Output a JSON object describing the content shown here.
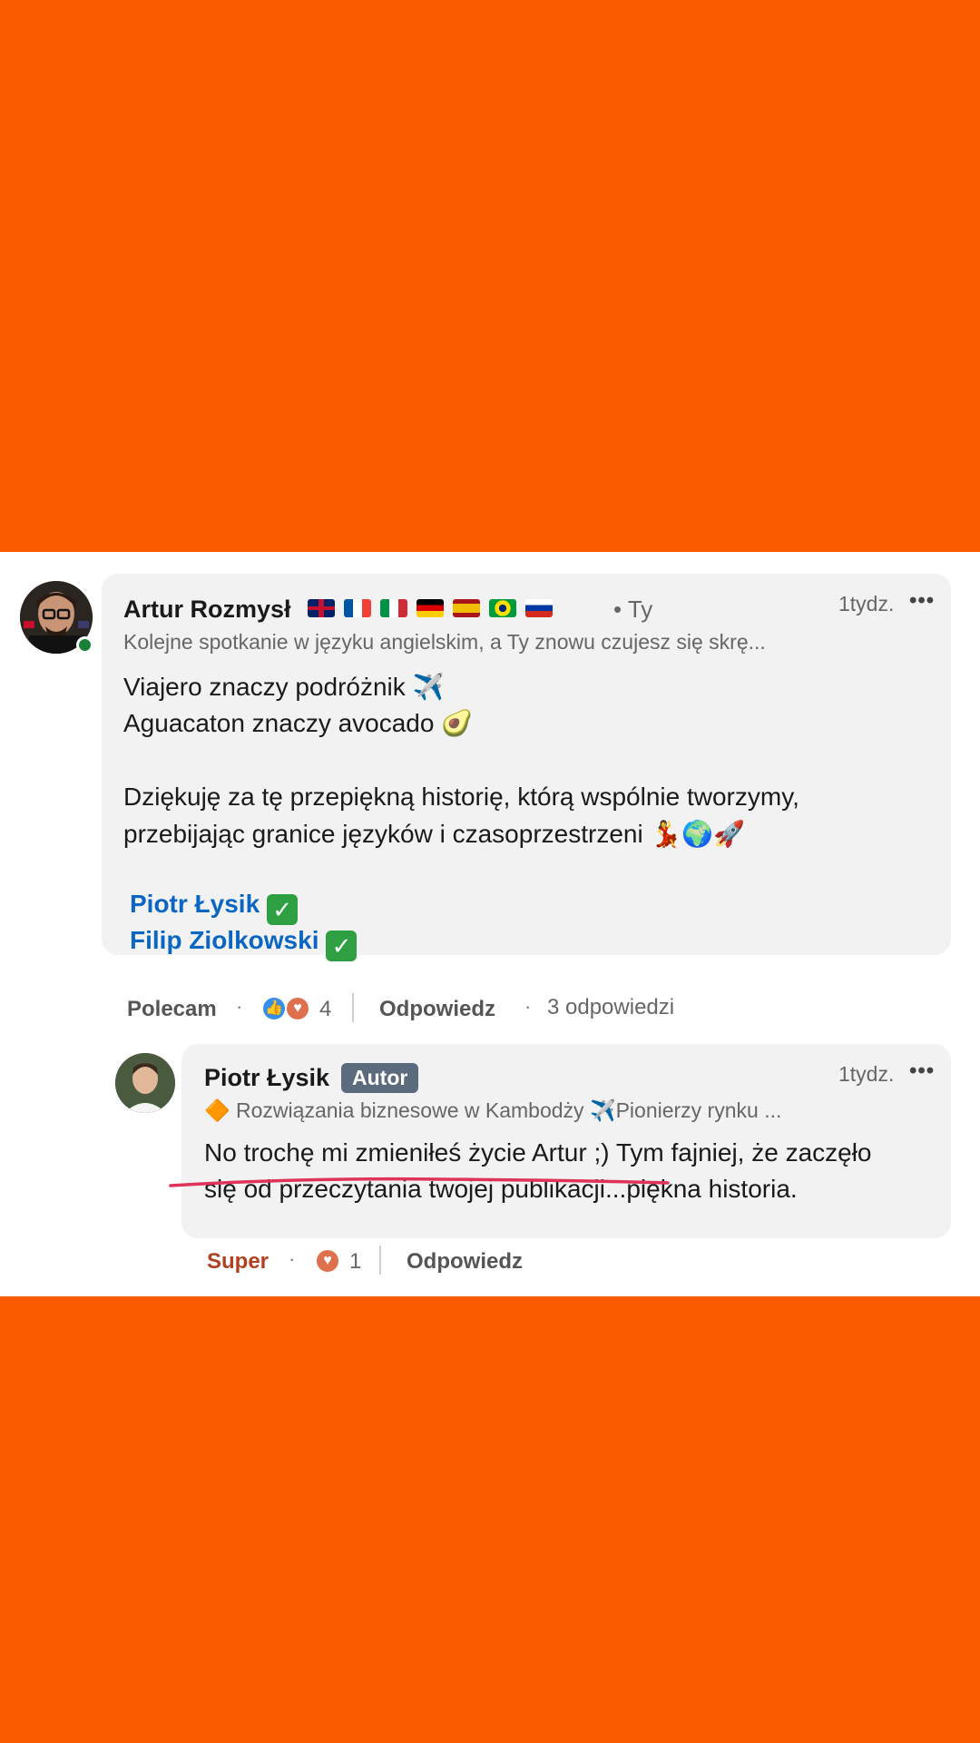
{
  "comment": {
    "author": "Artur Rozmysł",
    "you_label": "• Ty",
    "time": "1tydz.",
    "more": "•••",
    "headline": "Kolejne spotkanie w języku angielskim, a Ty znowu czujesz się skrę...",
    "lines": [
      "Viajero znaczy podróżnik ✈️",
      "Aguacaton znaczy avocado 🥑",
      "Dziękuję za tę przepiękną historię, którą wspólnie tworzymy,",
      "przebijając granice języków i czasoprzestrzeni 💃🌍🚀"
    ],
    "mentions": [
      "Piotr Łysik",
      "Filip Ziolkowski"
    ],
    "check_icon": "✓",
    "actions": {
      "like": "Polecam",
      "reaction_count": "4",
      "reply": "Odpowiedz",
      "replies_count": "3 odpowiedzi"
    }
  },
  "reply": {
    "author": "Piotr Łysik",
    "badge": "Autor",
    "time": "1tydz.",
    "more": "•••",
    "headline": "🔶 Rozwiązania biznesowe w Kambodży ✈️Pionierzy rynku ...",
    "lines": [
      "No trochę mi zmieniłeś życie Artur ;) Tym fajniej, że zaczęło",
      "się od przeczytania twojej publikacji...piękna historia."
    ],
    "actions": {
      "like": "Super",
      "reaction_count": "1",
      "reply": "Odpowiedz"
    }
  },
  "colors": {
    "background": "#FA5A00",
    "link": "#0a66c2",
    "super": "#b24020",
    "underline": "#e0335a"
  }
}
